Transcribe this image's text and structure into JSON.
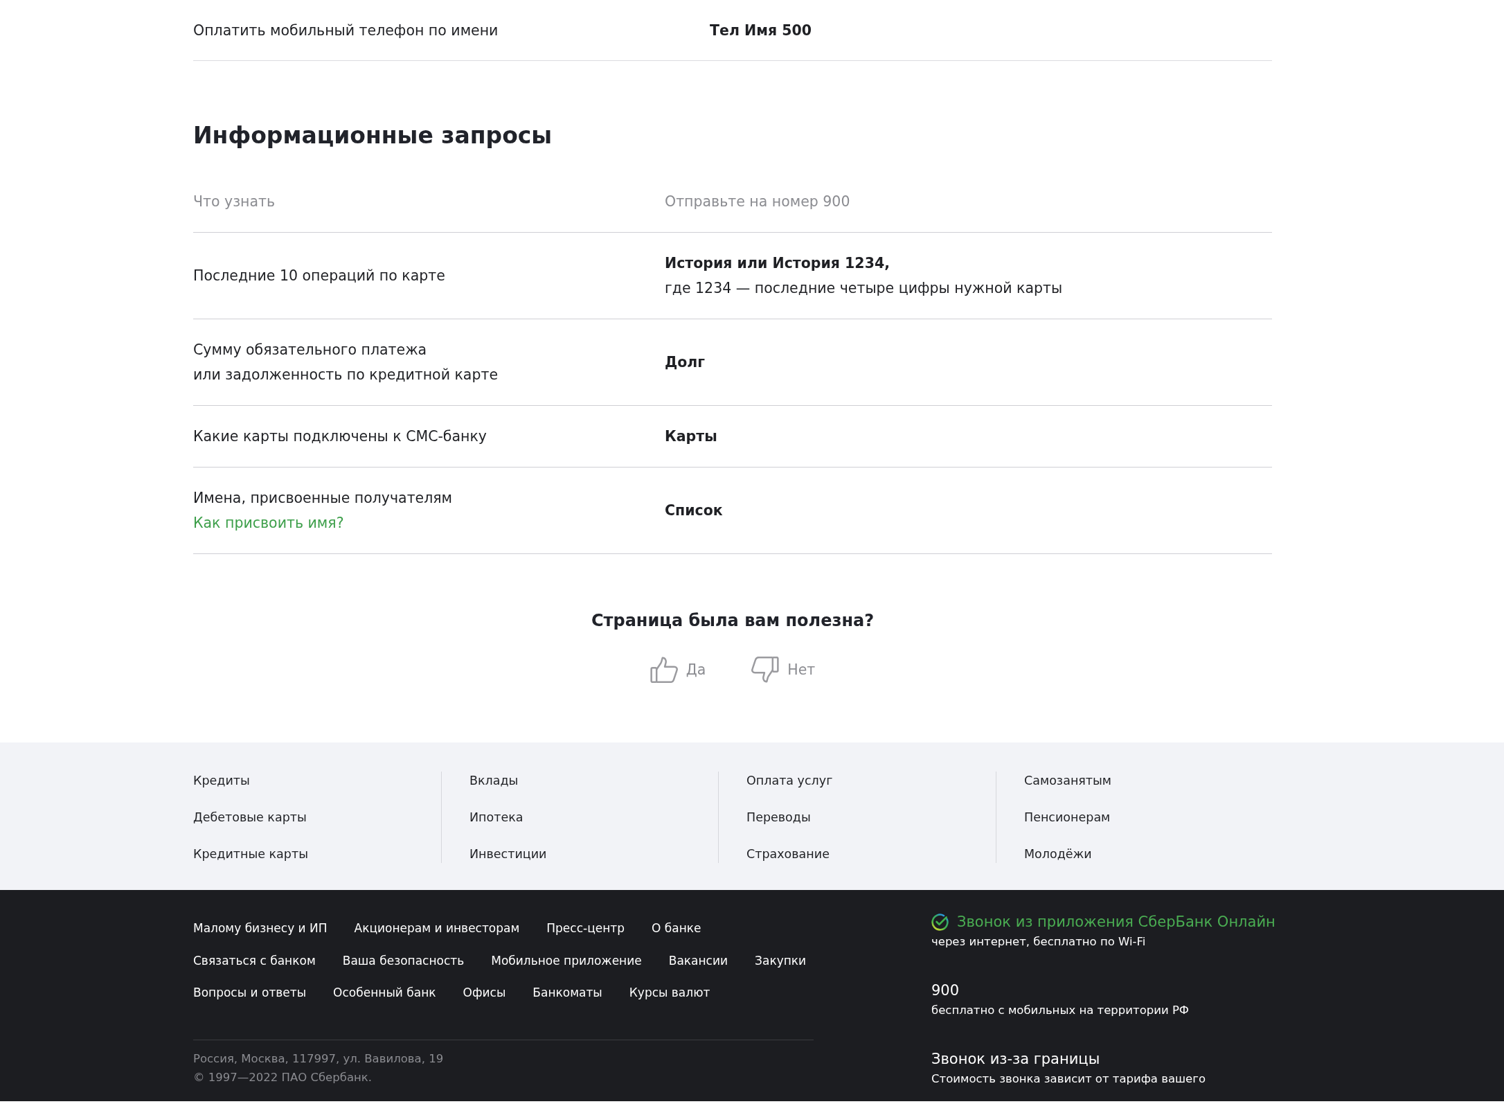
{
  "payment_table": {
    "rows": [
      {
        "action": "Оплатить мобильный телефон по имени",
        "command": "Тел Имя 500"
      }
    ]
  },
  "info_requests": {
    "title": "Информационные запросы",
    "columns": [
      "Что узнать",
      "Отправьте на номер 900"
    ],
    "rows": [
      {
        "what": "Последние 10 операций по карте",
        "command": "История или История 1234,",
        "note": "где 1234 — последние четыре цифры нужной карты"
      },
      {
        "what": "Сумму обязательного платежа\nили задолженность по кредитной карте",
        "command": "Долг"
      },
      {
        "what": "Какие карты подключены к СМС-банку",
        "command": "Карты"
      },
      {
        "what": "Имена, присвоенные получателям",
        "link": "Как присвоить имя?",
        "command": "Список"
      }
    ]
  },
  "feedback": {
    "question": "Страница была вам полезна?",
    "options": [
      {
        "kind": "yes",
        "label": "Да"
      },
      {
        "kind": "no",
        "label": "Нет"
      }
    ]
  },
  "product_links": {
    "columns": [
      {
        "links": [
          "Кредиты",
          "Дебетовые карты",
          "Кредитные карты"
        ]
      },
      {
        "links": [
          "Вклады",
          "Ипотека",
          "Инвестиции"
        ]
      },
      {
        "links": [
          "Оплата услуг",
          "Переводы",
          "Страхование"
        ]
      },
      {
        "links": [
          "Самозанятым",
          "Пенсионерам",
          "Молодёжи"
        ]
      }
    ]
  },
  "site_footer": {
    "link_rows": [
      [
        "Малому бизнесу и ИП",
        "Акционерам и инвесторам",
        "Пресс-центр",
        "О банке"
      ],
      [
        "Связаться с банком",
        "Ваша безопасность",
        "Мобильное приложение",
        "Вакансии",
        "Закупки"
      ],
      [
        "Вопросы и ответы",
        "Особенный банк",
        "Офисы",
        "Банкоматы",
        "Курсы валют"
      ]
    ],
    "address": "Россия, Москва, 117997, ул. Вавилова, 19",
    "copyright": "© 1997—2022 ПАО Сбербанк.",
    "contacts": [
      {
        "kind": "app",
        "title": "Звонок из приложения СберБанк Онлайн",
        "subtitle": "через интернет, бесплатно по Wi-Fi"
      },
      {
        "kind": "phone",
        "title": "900",
        "subtitle": "бесплатно с мобильных на территории РФ"
      },
      {
        "kind": "phone",
        "title": "Звонок из-за границы",
        "subtitle": "Стоимость звонка зависит от тарифа вашего"
      }
    ]
  }
}
